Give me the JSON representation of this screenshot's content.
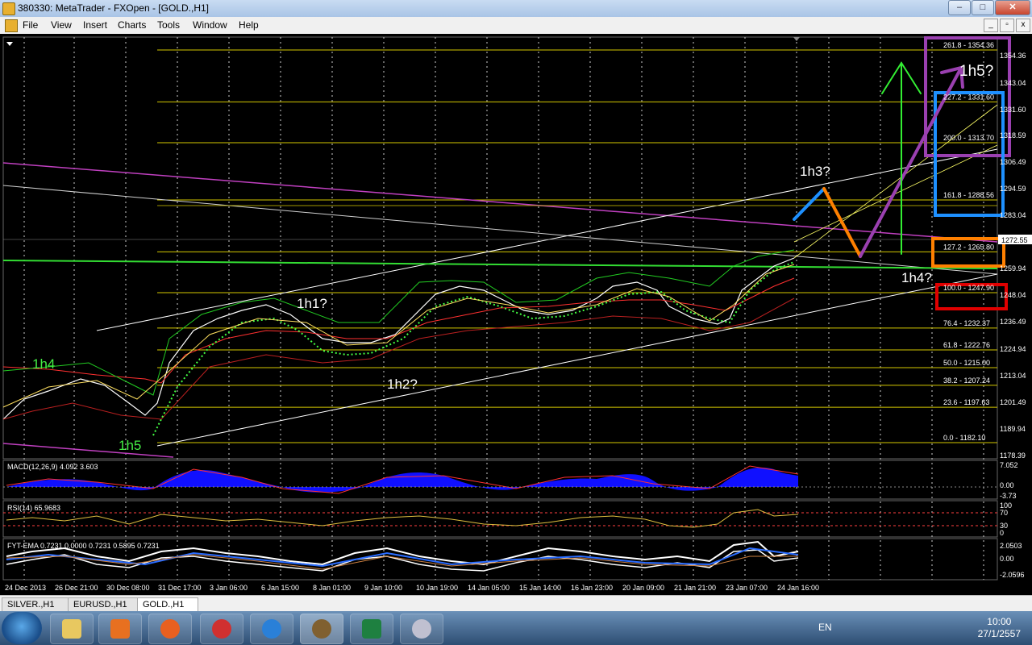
{
  "window": {
    "title": "380330: MetaTrader - FXOpen - [GOLD.,H1]",
    "buttons": {
      "minimize": "–",
      "maximize": "□",
      "close": "✕"
    }
  },
  "menu": [
    "File",
    "View",
    "Insert",
    "Charts",
    "Tools",
    "Window",
    "Help"
  ],
  "mdi_buttons": [
    "_",
    "▫",
    "x"
  ],
  "chart": {
    "symbol": "GOLD.,H1",
    "price_ticks": [
      "1354.36",
      "1343.04",
      "1331.60",
      "1318.59",
      "1306.49",
      "1294.59",
      "1283.04",
      "1272.55",
      "1259.94",
      "1248.04",
      "1236.49",
      "1224.94",
      "1213.04",
      "1201.49",
      "1189.94",
      "1178.39"
    ],
    "current_price": "1272.55",
    "fib_levels": [
      "261.8 - 1354.36",
      "227.2 - 1331.60",
      "200.0 - 1313.70",
      "161.8 - 1288.56",
      "127.2 - 1265.80",
      "100.0 - 1247.90",
      "76.4 - 1232.37",
      "61.8 - 1222.76",
      "50.0 - 1215.00",
      "38.2 - 1207.24",
      "23.6 - 1197.63",
      "0.0 - 1182.10"
    ],
    "time_labels": [
      "24 Dec 2013",
      "26 Dec 21:00",
      "30 Dec 08:00",
      "31 Dec 17:00",
      "3 Jan 06:00",
      "6 Jan 15:00",
      "8 Jan 01:00",
      "9 Jan 10:00",
      "10 Jan 19:00",
      "14 Jan 05:00",
      "15 Jan 14:00",
      "16 Jan 23:00",
      "20 Jan 09:00",
      "21 Jan 21:00",
      "23 Jan 07:00",
      "24 Jan 16:00"
    ],
    "annotations": {
      "h1": "1h1?",
      "h2": "1h2?",
      "h3": "1h3?",
      "h4": "1h4?",
      "h5": "1h5?",
      "h4_left": "1h4",
      "h5_left": "1h5"
    },
    "macd": {
      "label": "MACD(12,26,9) 4.092 3.603",
      "ticks": [
        "7.052",
        "0.00",
        "-3.73"
      ]
    },
    "rsi": {
      "label": "RSI(14) 65.9683",
      "ticks": [
        "100",
        "70",
        "30",
        "0"
      ]
    },
    "fxt": {
      "label": "FYT-EMA 0.7231 0.0000 0.7231 0.5895 0.7231",
      "ticks": [
        "2.0503",
        "0.00",
        "-2.0596"
      ]
    },
    "colors": {
      "fib": "#d4c800",
      "ma_green": "#00dd00",
      "magenta": "#c040c0",
      "blue_box": "#1e90ff",
      "orange_box": "#ff8000",
      "red_box": "#e00000",
      "purple_box": "#9a40b0"
    }
  },
  "tabs": [
    "SILVER.,H1",
    "EURUSD.,H1",
    "GOLD.,H1"
  ],
  "taskbar": {
    "language": "EN",
    "time": "10:00",
    "date": "27/1/2557"
  }
}
